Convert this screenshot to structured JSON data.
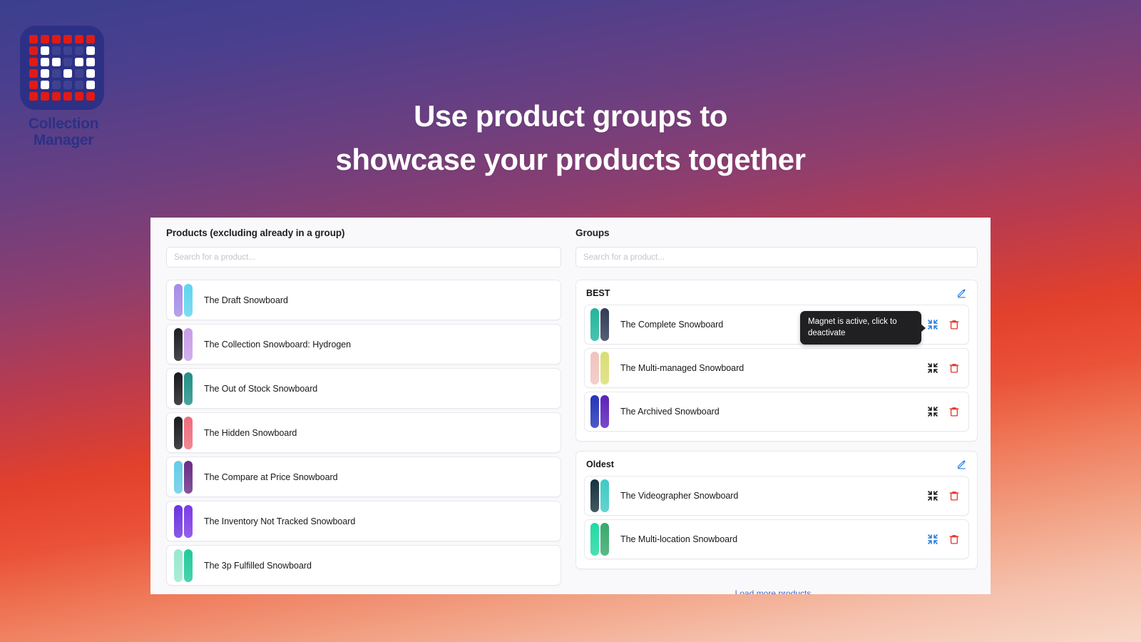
{
  "brand": {
    "name_line1": "Collection",
    "name_line2": "Manager",
    "logo_icon": "grid-logo-icon",
    "tile_color": "#2c3186",
    "accent_red": "#e01b16",
    "accent_white": "#ffffff",
    "accent_navy": "#3d4391",
    "grid": [
      [
        "red",
        "red",
        "red",
        "red",
        "red",
        "red"
      ],
      [
        "red",
        "white",
        "navy",
        "navy",
        "navy",
        "white"
      ],
      [
        "red",
        "white",
        "white",
        "navy",
        "white",
        "white"
      ],
      [
        "red",
        "white",
        "navy",
        "white",
        "navy",
        "white"
      ],
      [
        "red",
        "white",
        "navy",
        "navy",
        "navy",
        "white"
      ],
      [
        "red",
        "red",
        "red",
        "red",
        "red",
        "red"
      ]
    ]
  },
  "headline": {
    "line1": "Use product groups to",
    "line2": "showcase your products together"
  },
  "products_panel": {
    "title": "Products (excluding already in a group)",
    "search": {
      "value": "",
      "placeholder": "Search for a product..."
    },
    "items": [
      {
        "label": "The Draft Snowboard",
        "board_a": "#a58ae8",
        "board_b": "#5ed4ef"
      },
      {
        "label": "The Collection Snowboard: Hydrogen",
        "board_a": "#1c1c22",
        "board_b": "#c99ce8"
      },
      {
        "label": "The Out of Stock Snowboard",
        "board_a": "#17181d",
        "board_b": "#1f8f86"
      },
      {
        "label": "The Hidden Snowboard",
        "board_a": "#18181d",
        "board_b": "#f06b7a"
      },
      {
        "label": "The Compare at Price Snowboard",
        "board_a": "#63cbe8",
        "board_b": "#6a2a86"
      },
      {
        "label": "The Inventory Not Tracked Snowboard",
        "board_a": "#6b32e0",
        "board_b": "#7b3ae6"
      },
      {
        "label": "The 3p Fulfilled Snowboard",
        "board_a": "#97e8cf",
        "board_b": "#1fc99a"
      }
    ]
  },
  "groups_panel": {
    "title": "Groups",
    "search": {
      "value": "",
      "placeholder": "Search for a product..."
    },
    "edit_icon": "pencil-icon",
    "magnet_icon": "magnet-compress-icon",
    "delete_icon": "trash-icon",
    "magnet_active_color": "#2b7fe0",
    "magnet_inactive_color": "#1c1c1e",
    "delete_color": "#e8342b",
    "load_more_label": "Load more products",
    "groups": [
      {
        "name": "BEST",
        "items": [
          {
            "label": "The Complete Snowboard",
            "board_a": "#1fb59b",
            "board_b": "#2e3a55",
            "magnet_active": true
          },
          {
            "label": "The Multi-managed Snowboard",
            "board_a": "#f0c3bf",
            "board_b": "#d9dd72",
            "magnet_active": false
          },
          {
            "label": "The Archived Snowboard",
            "board_a": "#2233b8",
            "board_b": "#5a1fb8",
            "magnet_active": false
          }
        ]
      },
      {
        "name": "Oldest",
        "items": [
          {
            "label": "The Videographer Snowboard",
            "board_a": "#16313d",
            "board_b": "#3ec9c4",
            "magnet_active": false
          },
          {
            "label": "The Multi-location Snowboard",
            "board_a": "#1fd9a0",
            "board_b": "#35a86b",
            "magnet_active": true
          }
        ]
      }
    ]
  },
  "tooltip": {
    "text": "Magnet is active, click to deactivate"
  }
}
